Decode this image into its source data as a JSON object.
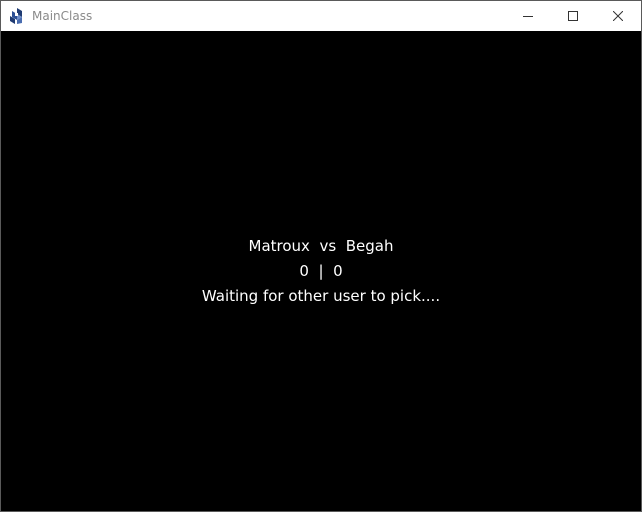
{
  "window": {
    "title": "MainClass",
    "icon": "java-app-icon",
    "controls": {
      "minimize": "minimize-icon",
      "maximize": "maximize-icon",
      "close": "close-icon"
    }
  },
  "game": {
    "player1": "Matroux",
    "vs": "vs",
    "player2": "Begah",
    "score1": "0",
    "separator": "|",
    "score2": "0",
    "status": "Waiting for other user to pick...."
  },
  "colors": {
    "background": "#000000",
    "text": "#ffffff",
    "titlebar": "#ffffff",
    "title_text": "#8a8a8a"
  }
}
